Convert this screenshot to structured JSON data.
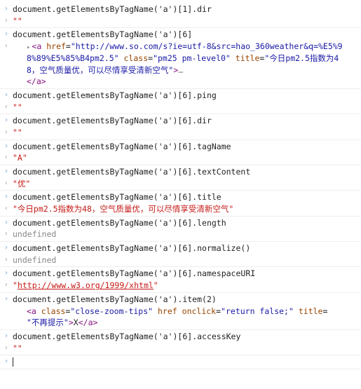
{
  "entries": [
    {
      "cmd": "document.getElementsByTagName('a')[1].dir",
      "result_type": "string",
      "result": "\"\""
    },
    {
      "cmd": "document.getElementsByTagName('a')[6]",
      "result_type": "element",
      "element": {
        "tag": "a",
        "href": "http://www.so.com/s?ie=utf-8&src=hao_360weather&q=%E5%98%89%E5%85%B4pm2.5",
        "klass": "pm25 pm-level0",
        "title": "今日pm2.5指数为48，空气质量优，可以尽情享受清新空气",
        "ellipsis": "…",
        "close": "</a>"
      }
    },
    {
      "cmd": "document.getElementsByTagName('a')[6].ping",
      "result_type": "string",
      "result": "\"\""
    },
    {
      "cmd": "document.getElementsByTagName('a')[6].dir",
      "result_type": "string",
      "result": "\"\""
    },
    {
      "cmd": "document.getElementsByTagName('a')[6].tagName",
      "result_type": "string",
      "result": "\"A\""
    },
    {
      "cmd": "document.getElementsByTagName('a')[6].textContent",
      "result_type": "string",
      "result": "\"优\""
    },
    {
      "cmd": "document.getElementsByTagName('a')[6].title",
      "result_type": "string",
      "result": "\"今日pm2.5指数为48，空气质量优，可以尽情享受清新空气\""
    },
    {
      "cmd": "document.getElementsByTagName('a')[6].length",
      "result_type": "undef",
      "result": "undefined"
    },
    {
      "cmd": "document.getElementsByTagName('a')[6].normalize()",
      "result_type": "undef",
      "result": "undefined"
    },
    {
      "cmd": "document.getElementsByTagName('a')[6].namespaceURI",
      "result_type": "link",
      "result": "\"http://www.w3.org/1999/xhtml\""
    },
    {
      "cmd": "document.getElementsByTagName('a').item(2)",
      "result_type": "element2",
      "element2": {
        "tag": "a",
        "klass": "close-zoom-tips",
        "href_attr": "href",
        "onclick": "return false;",
        "title": "不再提示",
        "text": "X",
        "close": "</a>"
      }
    },
    {
      "cmd": "document.getElementsByTagName('a')[6].accessKey",
      "result_type": "string",
      "result": "\"\""
    }
  ],
  "glyph": {
    "prompt": "›",
    "out": "‹",
    "expand": "▸"
  }
}
